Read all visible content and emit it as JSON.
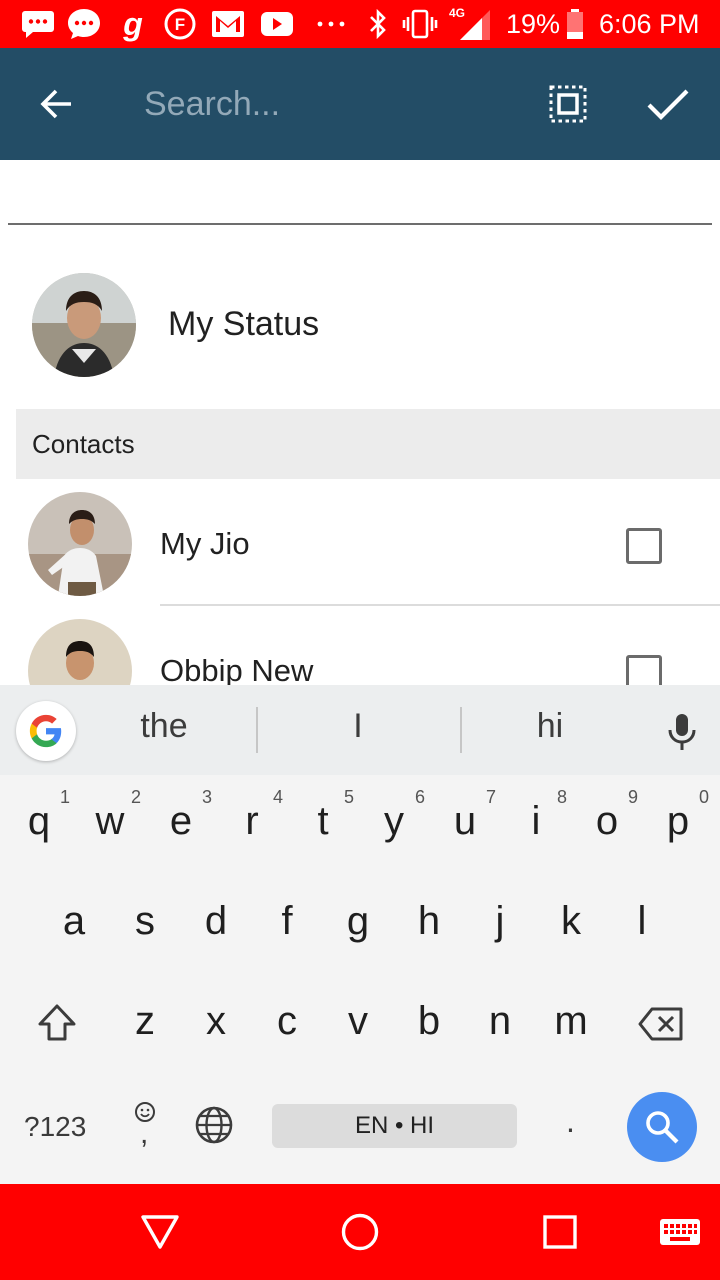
{
  "status_bar": {
    "notifications": [
      "message-icon",
      "chat-bubble-icon",
      "g-app-icon",
      "f-app-icon",
      "gmail-icon",
      "youtube-icon",
      "more-dots-icon"
    ],
    "battery": "19%",
    "time": "6:06 PM",
    "network": "4G",
    "color": "#ff0000"
  },
  "app_bar": {
    "search_placeholder": "Search...",
    "color": "#234d66"
  },
  "my_status": {
    "label": "My Status"
  },
  "section": {
    "title": "Contacts"
  },
  "contacts": [
    {
      "name": "My Jio",
      "checked": false
    },
    {
      "name": "Obbip New",
      "checked": false
    }
  ],
  "keyboard": {
    "suggestions": [
      "the",
      "I",
      "hi"
    ],
    "row1": [
      "q",
      "w",
      "e",
      "r",
      "t",
      "y",
      "u",
      "i",
      "o",
      "p"
    ],
    "row1_nums": [
      "1",
      "2",
      "3",
      "4",
      "5",
      "6",
      "7",
      "8",
      "9",
      "0"
    ],
    "row2": [
      "a",
      "s",
      "d",
      "f",
      "g",
      "h",
      "j",
      "k",
      "l"
    ],
    "row3": [
      "z",
      "x",
      "c",
      "v",
      "b",
      "n",
      "m"
    ],
    "symbols_label": "?123",
    "comma": ",",
    "period": ".",
    "space_label": "EN • HI",
    "accent": "#4a8ef1"
  },
  "nav_bar": {
    "color": "#ff0000"
  }
}
